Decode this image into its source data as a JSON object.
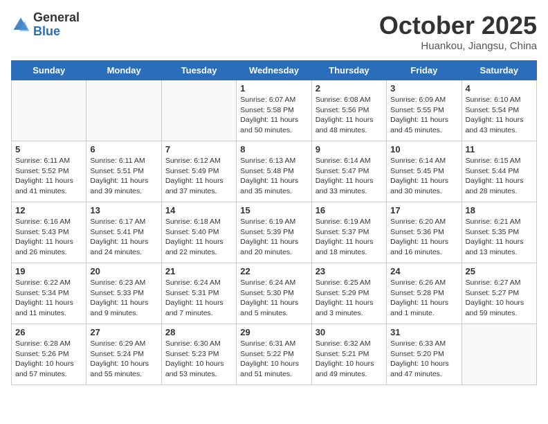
{
  "header": {
    "logo_general": "General",
    "logo_blue": "Blue",
    "month_title": "October 2025",
    "subtitle": "Huankou, Jiangsu, China"
  },
  "weekdays": [
    "Sunday",
    "Monday",
    "Tuesday",
    "Wednesday",
    "Thursday",
    "Friday",
    "Saturday"
  ],
  "weeks": [
    [
      {
        "day": "",
        "info": ""
      },
      {
        "day": "",
        "info": ""
      },
      {
        "day": "",
        "info": ""
      },
      {
        "day": "1",
        "info": "Sunrise: 6:07 AM\nSunset: 5:58 PM\nDaylight: 11 hours\nand 50 minutes."
      },
      {
        "day": "2",
        "info": "Sunrise: 6:08 AM\nSunset: 5:56 PM\nDaylight: 11 hours\nand 48 minutes."
      },
      {
        "day": "3",
        "info": "Sunrise: 6:09 AM\nSunset: 5:55 PM\nDaylight: 11 hours\nand 45 minutes."
      },
      {
        "day": "4",
        "info": "Sunrise: 6:10 AM\nSunset: 5:54 PM\nDaylight: 11 hours\nand 43 minutes."
      }
    ],
    [
      {
        "day": "5",
        "info": "Sunrise: 6:11 AM\nSunset: 5:52 PM\nDaylight: 11 hours\nand 41 minutes."
      },
      {
        "day": "6",
        "info": "Sunrise: 6:11 AM\nSunset: 5:51 PM\nDaylight: 11 hours\nand 39 minutes."
      },
      {
        "day": "7",
        "info": "Sunrise: 6:12 AM\nSunset: 5:49 PM\nDaylight: 11 hours\nand 37 minutes."
      },
      {
        "day": "8",
        "info": "Sunrise: 6:13 AM\nSunset: 5:48 PM\nDaylight: 11 hours\nand 35 minutes."
      },
      {
        "day": "9",
        "info": "Sunrise: 6:14 AM\nSunset: 5:47 PM\nDaylight: 11 hours\nand 33 minutes."
      },
      {
        "day": "10",
        "info": "Sunrise: 6:14 AM\nSunset: 5:45 PM\nDaylight: 11 hours\nand 30 minutes."
      },
      {
        "day": "11",
        "info": "Sunrise: 6:15 AM\nSunset: 5:44 PM\nDaylight: 11 hours\nand 28 minutes."
      }
    ],
    [
      {
        "day": "12",
        "info": "Sunrise: 6:16 AM\nSunset: 5:43 PM\nDaylight: 11 hours\nand 26 minutes."
      },
      {
        "day": "13",
        "info": "Sunrise: 6:17 AM\nSunset: 5:41 PM\nDaylight: 11 hours\nand 24 minutes."
      },
      {
        "day": "14",
        "info": "Sunrise: 6:18 AM\nSunset: 5:40 PM\nDaylight: 11 hours\nand 22 minutes."
      },
      {
        "day": "15",
        "info": "Sunrise: 6:19 AM\nSunset: 5:39 PM\nDaylight: 11 hours\nand 20 minutes."
      },
      {
        "day": "16",
        "info": "Sunrise: 6:19 AM\nSunset: 5:37 PM\nDaylight: 11 hours\nand 18 minutes."
      },
      {
        "day": "17",
        "info": "Sunrise: 6:20 AM\nSunset: 5:36 PM\nDaylight: 11 hours\nand 16 minutes."
      },
      {
        "day": "18",
        "info": "Sunrise: 6:21 AM\nSunset: 5:35 PM\nDaylight: 11 hours\nand 13 minutes."
      }
    ],
    [
      {
        "day": "19",
        "info": "Sunrise: 6:22 AM\nSunset: 5:34 PM\nDaylight: 11 hours\nand 11 minutes."
      },
      {
        "day": "20",
        "info": "Sunrise: 6:23 AM\nSunset: 5:33 PM\nDaylight: 11 hours\nand 9 minutes."
      },
      {
        "day": "21",
        "info": "Sunrise: 6:24 AM\nSunset: 5:31 PM\nDaylight: 11 hours\nand 7 minutes."
      },
      {
        "day": "22",
        "info": "Sunrise: 6:24 AM\nSunset: 5:30 PM\nDaylight: 11 hours\nand 5 minutes."
      },
      {
        "day": "23",
        "info": "Sunrise: 6:25 AM\nSunset: 5:29 PM\nDaylight: 11 hours\nand 3 minutes."
      },
      {
        "day": "24",
        "info": "Sunrise: 6:26 AM\nSunset: 5:28 PM\nDaylight: 11 hours\nand 1 minute."
      },
      {
        "day": "25",
        "info": "Sunrise: 6:27 AM\nSunset: 5:27 PM\nDaylight: 10 hours\nand 59 minutes."
      }
    ],
    [
      {
        "day": "26",
        "info": "Sunrise: 6:28 AM\nSunset: 5:26 PM\nDaylight: 10 hours\nand 57 minutes."
      },
      {
        "day": "27",
        "info": "Sunrise: 6:29 AM\nSunset: 5:24 PM\nDaylight: 10 hours\nand 55 minutes."
      },
      {
        "day": "28",
        "info": "Sunrise: 6:30 AM\nSunset: 5:23 PM\nDaylight: 10 hours\nand 53 minutes."
      },
      {
        "day": "29",
        "info": "Sunrise: 6:31 AM\nSunset: 5:22 PM\nDaylight: 10 hours\nand 51 minutes."
      },
      {
        "day": "30",
        "info": "Sunrise: 6:32 AM\nSunset: 5:21 PM\nDaylight: 10 hours\nand 49 minutes."
      },
      {
        "day": "31",
        "info": "Sunrise: 6:33 AM\nSunset: 5:20 PM\nDaylight: 10 hours\nand 47 minutes."
      },
      {
        "day": "",
        "info": ""
      }
    ]
  ]
}
